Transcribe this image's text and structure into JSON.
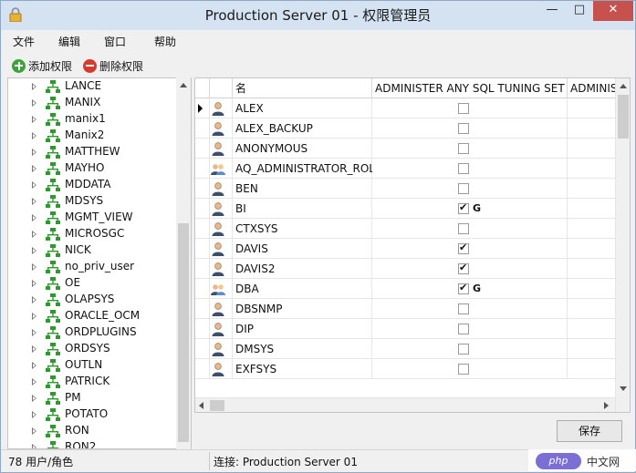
{
  "window": {
    "title": "Production Server 01 - 权限管理员",
    "minimize": "—",
    "maximize": "□",
    "close": "✕"
  },
  "menu": {
    "items": [
      "文件",
      "编辑",
      "窗口",
      "帮助"
    ]
  },
  "toolbar": {
    "add_label": "添加权限",
    "delete_label": "删除权限"
  },
  "tree": {
    "items": [
      "LANCE",
      "MANIX",
      "manix1",
      "Manix2",
      "MATTHEW",
      "MAYHO",
      "MDDATA",
      "MDSYS",
      "MGMT_VIEW",
      "MICROSGC",
      "NICK",
      "no_priv_user",
      "OE",
      "OLAPSYS",
      "ORACLE_OCM",
      "ORDPLUGINS",
      "ORDSYS",
      "OUTLN",
      "PATRICK",
      "PM",
      "POTATO",
      "RON",
      "RON2"
    ]
  },
  "grid": {
    "columns": {
      "name": "名",
      "privilege1": "ADMINISTER ANY SQL TUNING SET",
      "privilege2": "ADMINIS"
    },
    "rows": [
      {
        "name": "ALEX",
        "checked": false,
        "grant": "",
        "role": false,
        "selected": true
      },
      {
        "name": "ALEX_BACKUP",
        "checked": false,
        "grant": "",
        "role": false
      },
      {
        "name": "ANONYMOUS",
        "checked": false,
        "grant": "",
        "role": false
      },
      {
        "name": "AQ_ADMINISTRATOR_ROLE",
        "checked": false,
        "grant": "",
        "role": true
      },
      {
        "name": "BEN",
        "checked": false,
        "grant": "",
        "role": false
      },
      {
        "name": "BI",
        "checked": true,
        "grant": "G",
        "role": false
      },
      {
        "name": "CTXSYS",
        "checked": false,
        "grant": "",
        "role": false
      },
      {
        "name": "DAVIS",
        "checked": true,
        "grant": "",
        "role": false
      },
      {
        "name": "DAVIS2",
        "checked": true,
        "grant": "",
        "role": false
      },
      {
        "name": "DBA",
        "checked": true,
        "grant": "G",
        "role": true
      },
      {
        "name": "DBSNMP",
        "checked": false,
        "grant": "",
        "role": false
      },
      {
        "name": "DIP",
        "checked": false,
        "grant": "",
        "role": false
      },
      {
        "name": "DMSYS",
        "checked": false,
        "grant": "",
        "role": false
      },
      {
        "name": "EXFSYS",
        "checked": false,
        "grant": "",
        "role": false
      }
    ]
  },
  "save_button": "保存",
  "status": {
    "left": "78 用户/角色",
    "right": "连接: Production Server 01"
  },
  "watermark": {
    "badge": "php",
    "text": "中文网"
  },
  "colors": {
    "titlebar": "#d4e2f1",
    "close_button": "#c7514c",
    "tree_icon": "#2e9a2e"
  }
}
